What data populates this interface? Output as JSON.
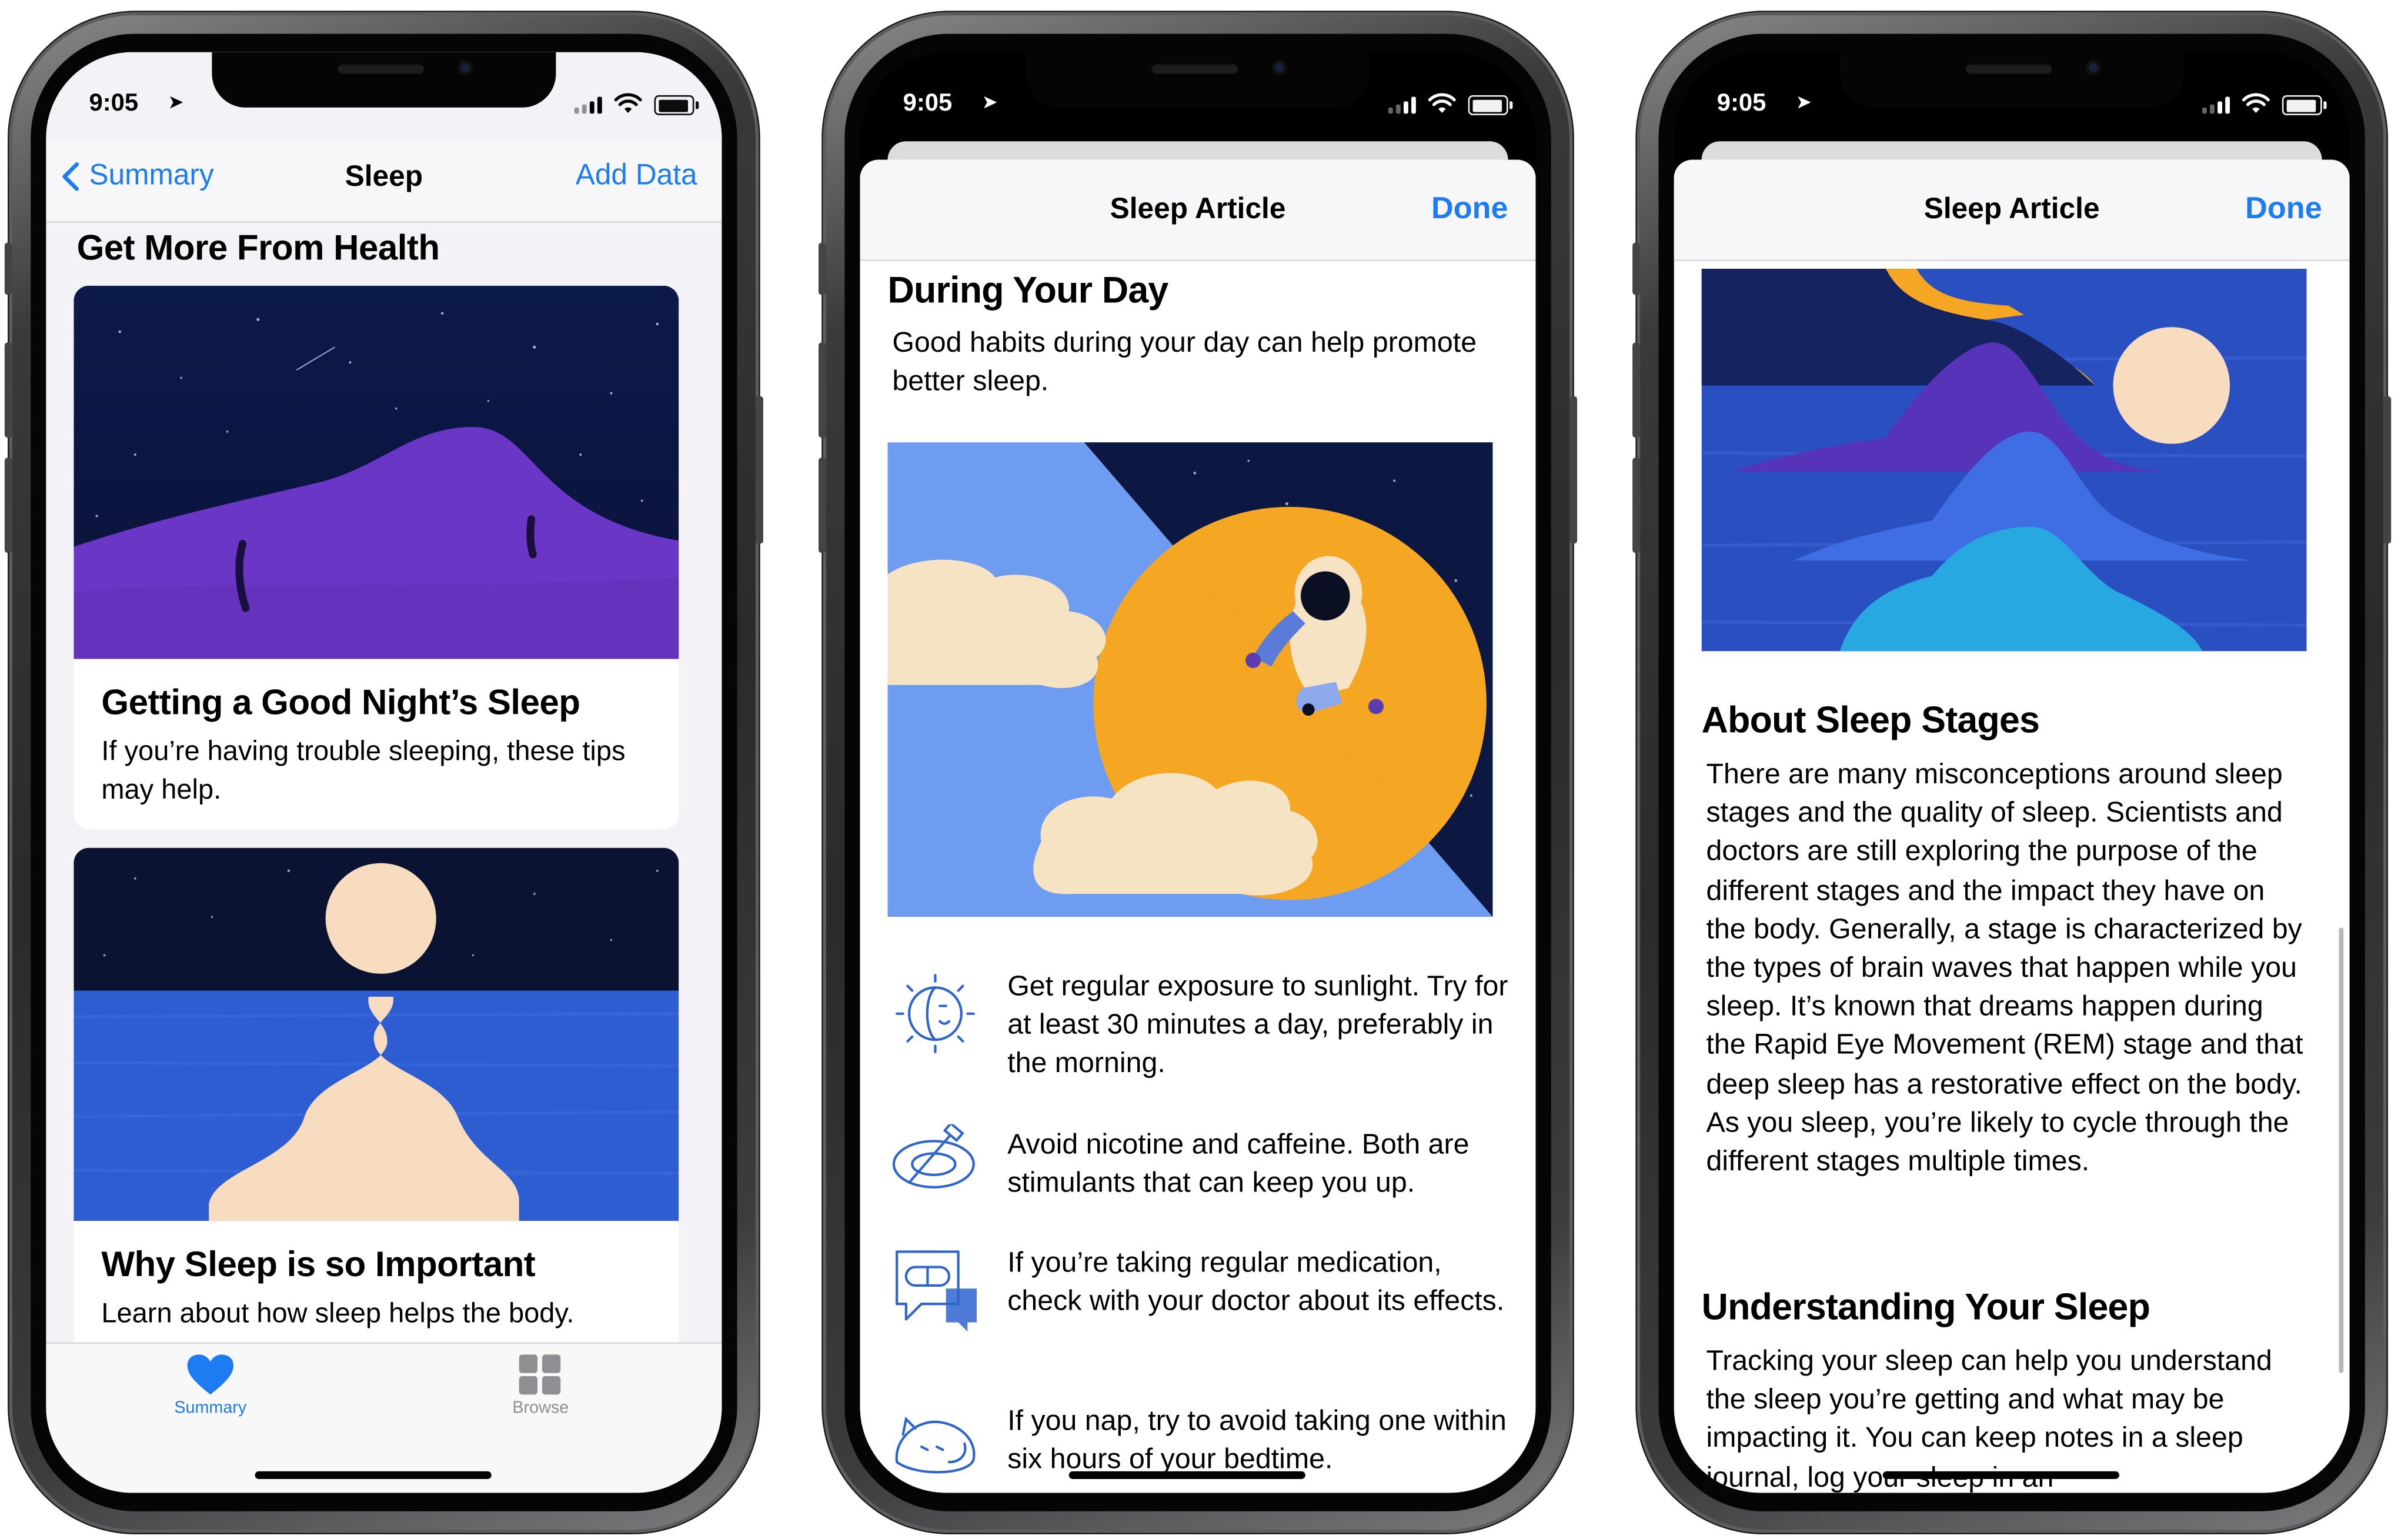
{
  "status": {
    "time": "9:05"
  },
  "phone1": {
    "nav": {
      "back_label": "Summary",
      "title": "Sleep",
      "action_label": "Add Data"
    },
    "section_title": "Get More From Health",
    "cards": [
      {
        "title": "Getting a Good Night’s Sleep",
        "subtitle": "If you’re having trouble sleeping, these tips may help."
      },
      {
        "title": "Why Sleep is so Important",
        "subtitle": "Learn about how sleep helps the body."
      }
    ],
    "tabs": [
      {
        "label": "Summary",
        "icon": "heart-icon",
        "active": true
      },
      {
        "label": "Browse",
        "icon": "grid-icon",
        "active": false
      }
    ]
  },
  "phone2": {
    "header": {
      "title": "Sleep Article",
      "done_label": "Done"
    },
    "heading": "During Your Day",
    "intro": "Good habits during your day can help promote better sleep.",
    "tips": [
      {
        "icon": "sun-face-icon",
        "text": "Get regular exposure to sunlight. Try for at least 30 minutes a day, preferably in the morning."
      },
      {
        "icon": "coffee-cigarette-icon",
        "text": "Avoid nicotine and caffeine. Both are stimulants that can keep you up."
      },
      {
        "icon": "pill-chat-icon",
        "text": "If you’re taking regular medication, check with your doctor about its effects."
      },
      {
        "icon": "sleeping-cat-icon",
        "text": "If you nap, try to avoid taking one within six hours of your bedtime."
      }
    ]
  },
  "phone3": {
    "header": {
      "title": "Sleep Article",
      "done_label": "Done"
    },
    "sections": [
      {
        "heading": "About Sleep Stages",
        "body": "There are many misconceptions around sleep stages and the quality of sleep. Scientists and doctors are still exploring the purpose of the different stages and the impact they have on the body. Generally, a stage is characterized by the types of brain waves that happen while you sleep. It’s known that dreams happen during the Rapid Eye Movement (REM) stage and that deep sleep has a restorative effect on the body. As you sleep, you’re likely to cycle through the different stages multiple times."
      },
      {
        "heading": "Understanding Your Sleep",
        "body": "Tracking your sleep can help you understand the sleep you’re getting and what may be impacting it. You can keep notes in a sleep journal, log your sleep in an"
      }
    ]
  },
  "colors": {
    "accent": "#1e7cf2",
    "night_sky": "#0b1740",
    "purple": "#6a36c6",
    "moon": "#f7dcbf",
    "sun": "#f5a623",
    "water": "#2f5fd0"
  }
}
